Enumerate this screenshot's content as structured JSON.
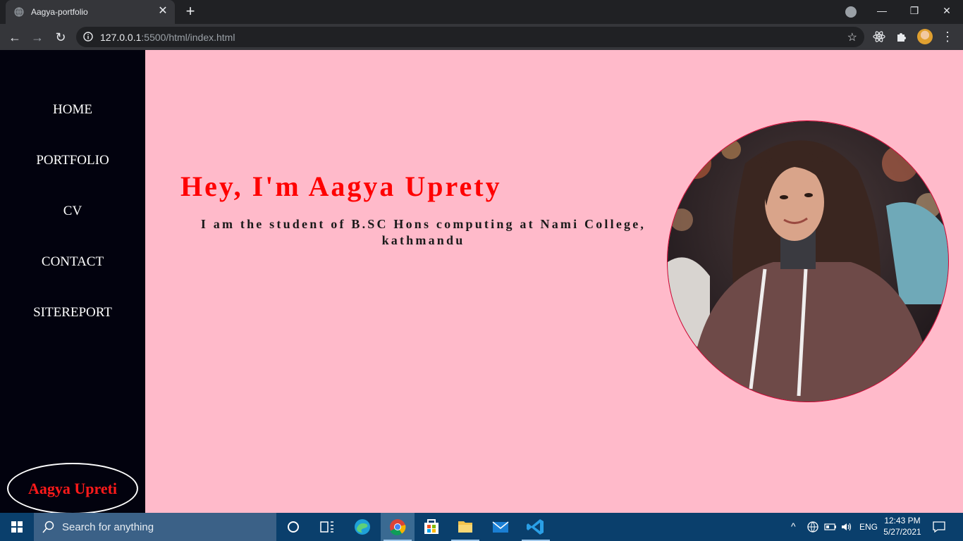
{
  "browser": {
    "tab_title": "Aagya-portfolio",
    "url_host": "127.0.0.1",
    "url_rest": ":5500/html/index.html"
  },
  "sidebar": {
    "items": [
      {
        "label": "HOME"
      },
      {
        "label": "PORTFOLIO"
      },
      {
        "label": "CV"
      },
      {
        "label": "CONTACT"
      },
      {
        "label": "SITEREPORT"
      }
    ],
    "badge": "Aagya Upreti"
  },
  "hero": {
    "title": "Hey, I'm Aagya Uprety",
    "subtitle": "I am the student of B.SC Hons computing at Nami College, kathmandu"
  },
  "taskbar": {
    "search_placeholder": "Search for anything",
    "lang": "ENG",
    "time": "12:43 PM",
    "date": "5/27/2021"
  },
  "colors": {
    "page_bg": "#ffbaca",
    "sidebar_bg": "#02020e",
    "accent": "#ff0000"
  }
}
